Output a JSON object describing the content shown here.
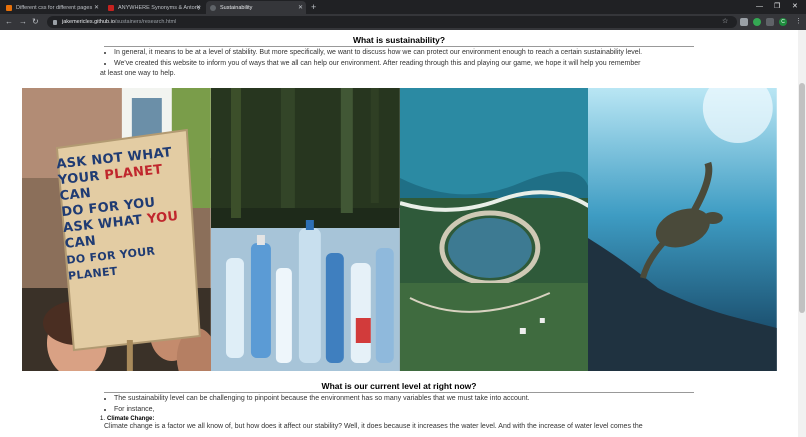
{
  "browser": {
    "tabs": [
      {
        "title": "Different css for different pages",
        "favicon_color": "#e8710a",
        "active": false
      },
      {
        "title": "ANYWHERE Synonyms & Antony",
        "favicon_color": "#c5221f",
        "active": false
      },
      {
        "title": "Sustainability",
        "favicon_color": "#5f6368",
        "active": true
      }
    ],
    "new_tab_label": "+",
    "address_host": "jakemericles.github.io",
    "address_path": "/sustainers/research.html",
    "profile_initial": "C"
  },
  "section1": {
    "title": "What is sustainability?",
    "bullets": [
      "In general, it means to be at a level of stability. But more specifically, we want to discuss how we can protect our environment enough to reach a certain sustainability level.",
      "We've created this website to inform you of ways that we all can help our environment. After reading through this and playing our game, we hope it will help you remember"
    ],
    "continuation": "at least one way to help."
  },
  "images": {
    "sign_lines": [
      {
        "a": "ASK NOT WHAT",
        "b": ""
      },
      {
        "a": "YOUR ",
        "b": "PLANET",
        "c": " CAN"
      },
      {
        "a": "DO FOR YOU",
        "b": ""
      },
      {
        "a": "ASK WHAT ",
        "b": "YOU",
        "c": " CAN"
      },
      {
        "a": "DO FOR YOUR PLANET",
        "b": ""
      }
    ]
  },
  "section2": {
    "title": "What is our current level at right now?",
    "bullets": [
      "The sustainability level can be challenging to pinpoint because the environment has so many variables that we must take into account.",
      "For instance,"
    ],
    "list_number": "1.",
    "list_heading": "Climate Change:",
    "paragraph": "Climate change is a factor we all know of, but how does it affect our stability? Well, it does because it increases the water level. And with the increase of water level comes the"
  }
}
